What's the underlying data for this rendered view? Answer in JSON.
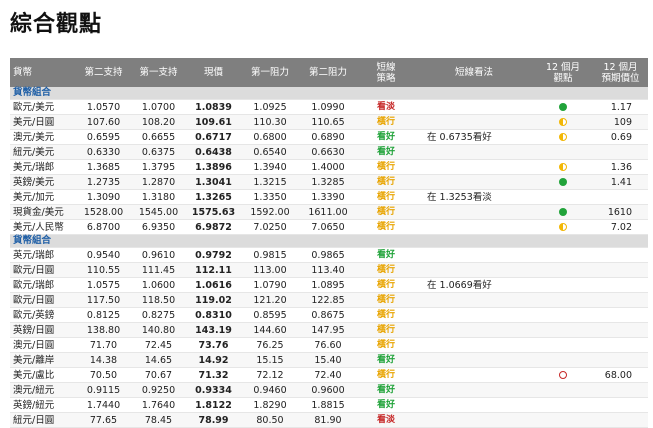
{
  "page": {
    "title": "綜合觀點"
  },
  "headers": {
    "name": "貨幣",
    "s2": "第二支持",
    "s1": "第一支持",
    "current": "現價",
    "r1": "第一阻力",
    "r2": "第二阻力",
    "signal": "短線\n策略",
    "view": "短線看法",
    "outlook": "12 個月\n觀點",
    "target": "12 個月\n預期價位"
  },
  "colors": {
    "header_bg": "#7f7f7f",
    "section_text": "#1f5fa6",
    "green": "#21a33a",
    "orange": "#e8a400",
    "red": "#c62828",
    "indicator_green": "#21a33a",
    "indicator_half": "#f2b705",
    "indicator_red": "#c62828"
  },
  "sections": [
    {
      "label": "貨幣組合",
      "rows": [
        {
          "name": "歐元/美元",
          "s2": "1.0570",
          "s1": "1.0700",
          "current": "1.0839",
          "r1": "1.0925",
          "r2": "1.0990",
          "signal": "看淡",
          "signal_color": "red",
          "view": "",
          "outlook": "green-circle",
          "target": "1.17"
        },
        {
          "name": "美元/日圓",
          "s2": "107.60",
          "s1": "108.20",
          "current": "109.61",
          "r1": "110.30",
          "r2": "110.65",
          "signal": "橫行",
          "signal_color": "orange",
          "view": "",
          "outlook": "half-circle",
          "target": "109"
        },
        {
          "name": "澳元/美元",
          "s2": "0.6595",
          "s1": "0.6655",
          "current": "0.6717",
          "r1": "0.6800",
          "r2": "0.6890",
          "signal": "看好",
          "signal_color": "green",
          "view": "在 0.6735看好",
          "outlook": "half-circle",
          "target": "0.69"
        },
        {
          "name": "紐元/美元",
          "s2": "0.6330",
          "s1": "0.6375",
          "current": "0.6438",
          "r1": "0.6540",
          "r2": "0.6630",
          "signal": "看好",
          "signal_color": "green",
          "view": "",
          "outlook": "",
          "target": ""
        },
        {
          "name": "美元/瑞郎",
          "s2": "1.3685",
          "s1": "1.3795",
          "current": "1.3896",
          "r1": "1.3940",
          "r2": "1.4000",
          "signal": "橫行",
          "signal_color": "orange",
          "view": "",
          "outlook": "half-circle",
          "target": "1.36"
        },
        {
          "name": "英鎊/美元",
          "s2": "1.2735",
          "s1": "1.2870",
          "current": "1.3041",
          "r1": "1.3215",
          "r2": "1.3285",
          "signal": "橫行",
          "signal_color": "orange",
          "view": "",
          "outlook": "green-circle",
          "target": "1.41"
        },
        {
          "name": "美元/加元",
          "s2": "1.3090",
          "s1": "1.3180",
          "current": "1.3265",
          "r1": "1.3350",
          "r2": "1.3390",
          "signal": "橫行",
          "signal_color": "orange",
          "view": "在 1.3253看淡",
          "outlook": "",
          "target": ""
        },
        {
          "name": "現貨金/美元",
          "s2": "1528.00",
          "s1": "1545.00",
          "current": "1575.63",
          "r1": "1592.00",
          "r2": "1611.00",
          "signal": "橫行",
          "signal_color": "orange",
          "view": "",
          "outlook": "green-circle",
          "target": "1610"
        },
        {
          "name": "美元/人民幣",
          "s2": "6.8700",
          "s1": "6.9350",
          "current": "6.9872",
          "r1": "7.0250",
          "r2": "7.0650",
          "signal": "橫行",
          "signal_color": "orange",
          "view": "",
          "outlook": "half-circle",
          "target": "7.02"
        }
      ]
    },
    {
      "label": "貨幣組合",
      "rows": [
        {
          "name": "英元/瑞郎",
          "s2": "0.9540",
          "s1": "0.9610",
          "current": "0.9792",
          "r1": "0.9815",
          "r2": "0.9865",
          "signal": "看好",
          "signal_color": "green",
          "view": "",
          "outlook": "",
          "target": ""
        },
        {
          "name": "歐元/日圓",
          "s2": "110.55",
          "s1": "111.45",
          "current": "112.11",
          "r1": "113.00",
          "r2": "113.40",
          "signal": "橫行",
          "signal_color": "orange",
          "view": "",
          "outlook": "",
          "target": ""
        },
        {
          "name": "歐元/瑞郎",
          "s2": "1.0575",
          "s1": "1.0600",
          "current": "1.0616",
          "r1": "1.0790",
          "r2": "1.0895",
          "signal": "橫行",
          "signal_color": "orange",
          "view": "在 1.0669看好",
          "outlook": "",
          "target": ""
        },
        {
          "name": "歐元/日圓",
          "s2": "117.50",
          "s1": "118.50",
          "current": "119.02",
          "r1": "121.20",
          "r2": "122.85",
          "signal": "橫行",
          "signal_color": "orange",
          "view": "",
          "outlook": "",
          "target": ""
        },
        {
          "name": "歐元/英鎊",
          "s2": "0.8125",
          "s1": "0.8275",
          "current": "0.8310",
          "r1": "0.8595",
          "r2": "0.8675",
          "signal": "橫行",
          "signal_color": "orange",
          "view": "",
          "outlook": "",
          "target": ""
        },
        {
          "name": "英鎊/日圓",
          "s2": "138.80",
          "s1": "140.80",
          "current": "143.19",
          "r1": "144.60",
          "r2": "147.95",
          "signal": "橫行",
          "signal_color": "orange",
          "view": "",
          "outlook": "",
          "target": ""
        },
        {
          "name": "澳元/日圓",
          "s2": "71.70",
          "s1": "72.45",
          "current": "73.76",
          "r1": "76.25",
          "r2": "76.60",
          "signal": "橫行",
          "signal_color": "orange",
          "view": "",
          "outlook": "",
          "target": ""
        },
        {
          "name": "美元/離岸",
          "s2": "14.38",
          "s1": "14.65",
          "current": "14.92",
          "r1": "15.15",
          "r2": "15.40",
          "signal": "看好",
          "signal_color": "green",
          "view": "",
          "outlook": "",
          "target": ""
        },
        {
          "name": "美元/盧比",
          "s2": "70.50",
          "s1": "70.67",
          "current": "71.32",
          "r1": "72.12",
          "r2": "72.40",
          "signal": "橫行",
          "signal_color": "orange",
          "view": "",
          "outlook": "red-circle",
          "target": "68.00"
        },
        {
          "name": "澳元/紐元",
          "s2": "0.9115",
          "s1": "0.9250",
          "current": "0.9334",
          "r1": "0.9460",
          "r2": "0.9600",
          "signal": "看好",
          "signal_color": "green",
          "view": "",
          "outlook": "",
          "target": ""
        },
        {
          "name": "英鎊/紐元",
          "s2": "1.7440",
          "s1": "1.7640",
          "current": "1.8122",
          "r1": "1.8290",
          "r2": "1.8815",
          "signal": "看好",
          "signal_color": "green",
          "view": "",
          "outlook": "",
          "target": ""
        },
        {
          "name": "紐元/日圓",
          "s2": "77.65",
          "s1": "78.45",
          "current": "78.99",
          "r1": "80.50",
          "r2": "81.90",
          "signal": "看淡",
          "signal_color": "red",
          "view": "",
          "outlook": "",
          "target": ""
        }
      ]
    }
  ]
}
